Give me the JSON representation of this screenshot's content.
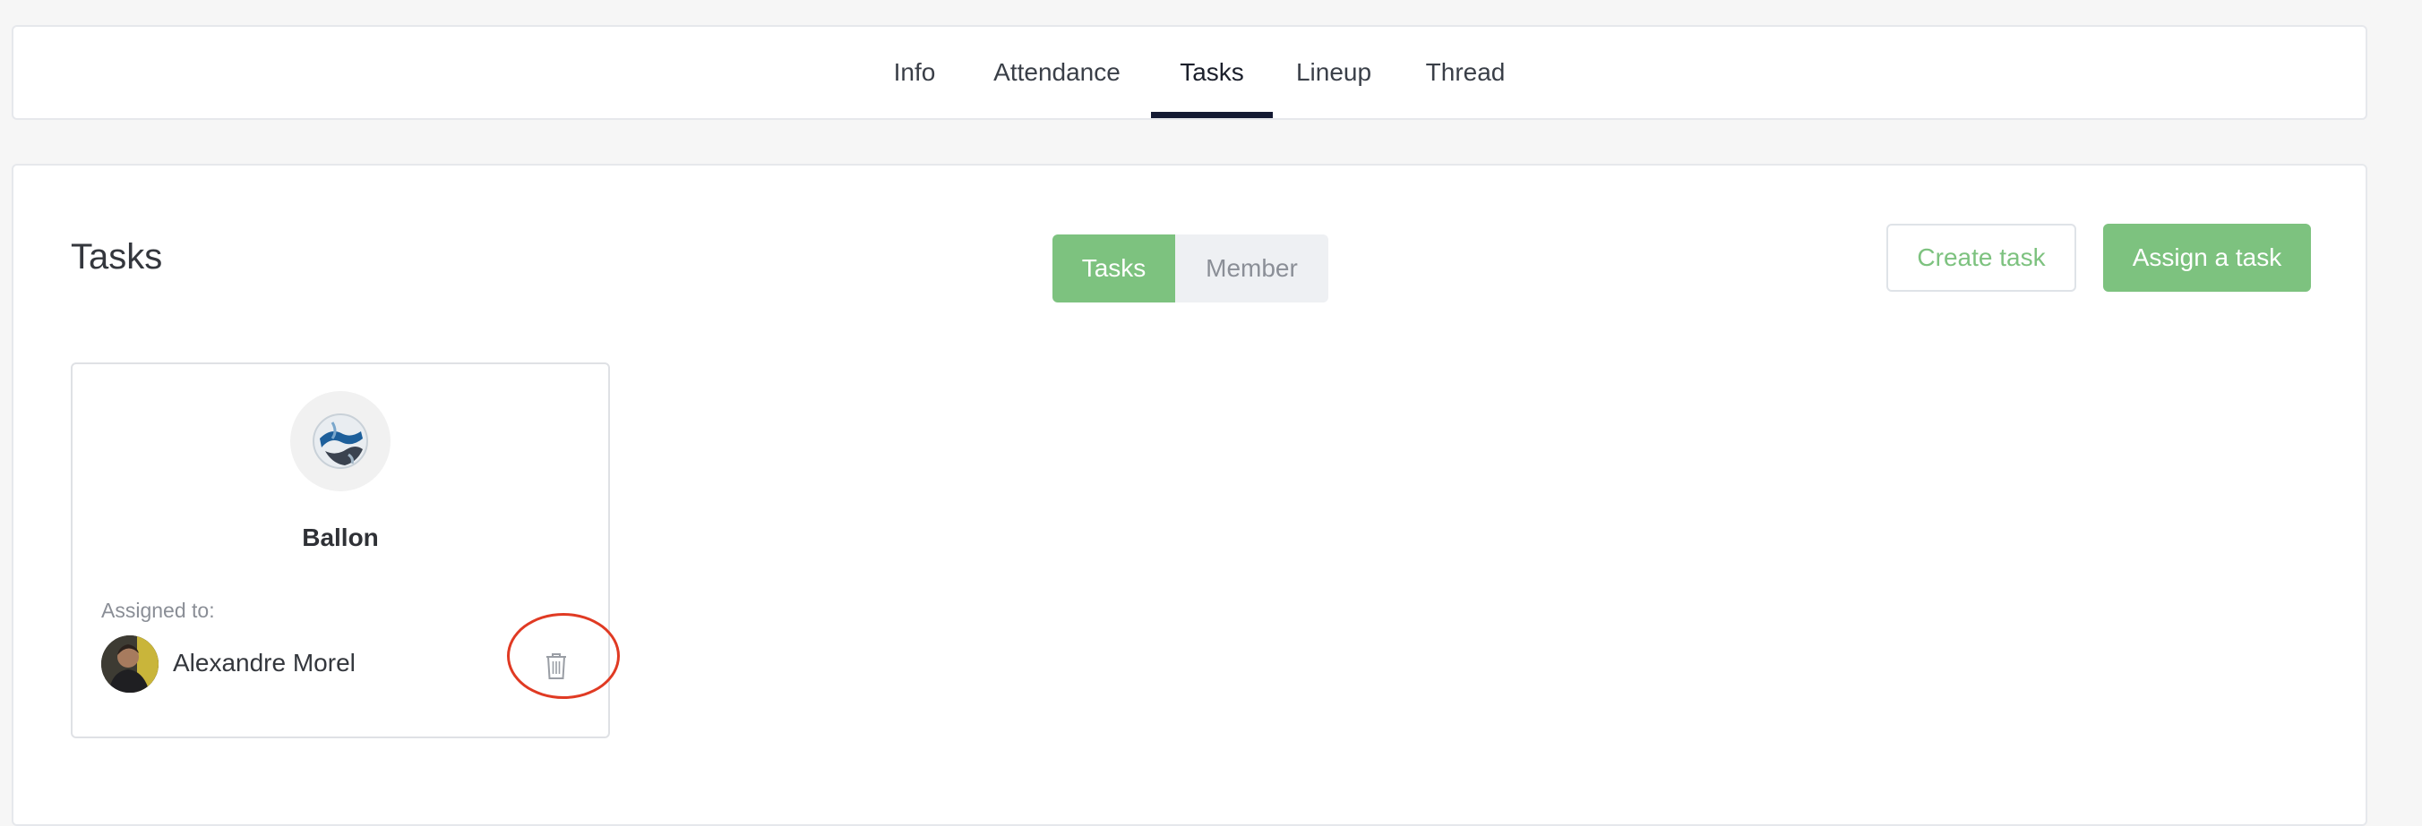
{
  "tabs": [
    {
      "label": "Info",
      "active": false
    },
    {
      "label": "Attendance",
      "active": false
    },
    {
      "label": "Tasks",
      "active": true
    },
    {
      "label": "Lineup",
      "active": false
    },
    {
      "label": "Thread",
      "active": false
    }
  ],
  "panel": {
    "title": "Tasks",
    "toggle": {
      "tasks_label": "Tasks",
      "member_label": "Member",
      "selected": "Tasks"
    },
    "create_task_label": "Create task",
    "assign_task_label": "Assign a task"
  },
  "task_card": {
    "image_icon": "soccer-ball-image",
    "name": "Ballon",
    "assigned_label": "Assigned to:",
    "assignee": "Alexandre Morel",
    "delete_icon": "trash-icon"
  },
  "colors": {
    "accent": "#7dc27f",
    "tab_underline": "#141a33",
    "annotation": "#e03a23"
  }
}
